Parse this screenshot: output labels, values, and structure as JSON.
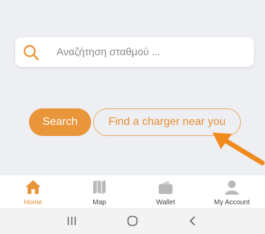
{
  "search": {
    "placeholder": "Αναζήτηση σταθμού ...",
    "value": ""
  },
  "actions": {
    "search_label": "Search",
    "find_charger_label": "Find a charger near you"
  },
  "bottom_nav": {
    "items": [
      {
        "label": "Home",
        "icon": "home-icon",
        "active": true
      },
      {
        "label": "Map",
        "icon": "map-icon",
        "active": false
      },
      {
        "label": "Wallet",
        "icon": "wallet-icon",
        "active": false
      },
      {
        "label": "My Account",
        "icon": "account-icon",
        "active": false
      }
    ]
  },
  "system_nav": {
    "items": [
      "recent-apps-icon",
      "home-circle-icon",
      "back-icon"
    ]
  },
  "colors": {
    "accent": "#e9953a",
    "inactive_icon": "#b9b9b9",
    "background": "#eeeff3"
  }
}
